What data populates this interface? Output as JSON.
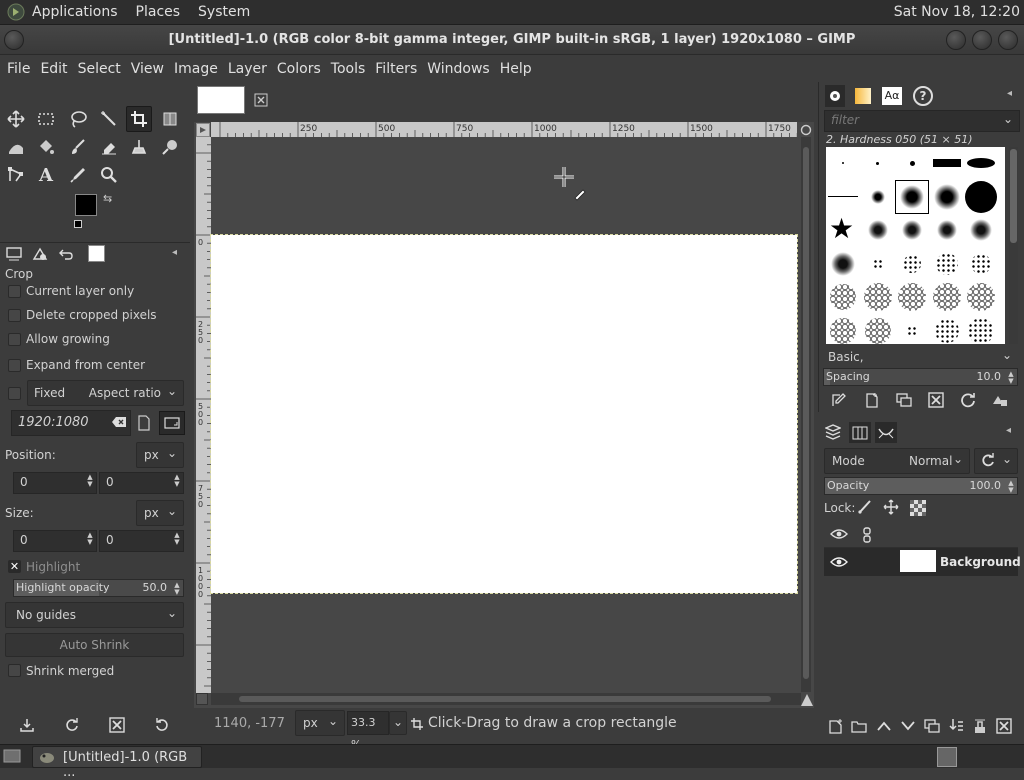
{
  "top_panel": {
    "menus": [
      "Applications",
      "Places",
      "System"
    ],
    "clock": "Sat Nov 18, 12:20"
  },
  "window": {
    "title": "[Untitled]-1.0 (RGB color 8-bit gamma integer, GIMP built-in sRGB, 1 layer) 1920x1080 – GIMP"
  },
  "menubar": {
    "items": [
      "File",
      "Edit",
      "Select",
      "View",
      "Image",
      "Layer",
      "Colors",
      "Tools",
      "Filters",
      "Windows",
      "Help"
    ]
  },
  "toolbox": {
    "tools": [
      "move-icon",
      "rect-select-icon",
      "lasso-icon",
      "fuzzy-select-icon",
      "crop-icon",
      "unified-transform-icon",
      "warp-icon",
      "bucket-fill-icon",
      "paintbrush-icon",
      "eraser-icon",
      "clone-icon",
      "smudge-icon",
      "paths-icon",
      "text-icon",
      "color-picker-icon",
      "zoom-icon"
    ],
    "active_tool": "crop-icon"
  },
  "tool_options": {
    "title": "Crop",
    "current_layer_only": "Current layer only",
    "delete_cropped_pixels": "Delete cropped pixels",
    "allow_growing": "Allow growing",
    "expand_from_center": "Expand from center",
    "fixed_label": "Fixed",
    "fixed_mode": "Aspect ratio",
    "ratio_value": "1920:1080",
    "position_label": "Position:",
    "position_unit": "px",
    "position_x": "0",
    "position_y": "0",
    "size_label": "Size:",
    "size_unit": "px",
    "size_w": "0",
    "size_h": "0",
    "highlight_label": "Highlight",
    "highlight_opacity_label": "Highlight opacity",
    "highlight_opacity_value": "50.0",
    "highlight_opacity_fraction": 0.5,
    "guides": "No guides",
    "auto_shrink": "Auto Shrink",
    "shrink_merged": "Shrink merged"
  },
  "canvas": {
    "ruler_h_labels": [
      "250",
      "500",
      "750",
      "1000",
      "1250",
      "1500",
      "1750"
    ],
    "ruler_v_labels": [
      "0",
      "250",
      "500",
      "750",
      "1000"
    ],
    "pointer_coords": "1140, -177",
    "unit": "px",
    "zoom": "33.3 %",
    "status_message": "Click-Drag to draw a crop rectangle"
  },
  "brushes": {
    "filter_placeholder": "filter",
    "selected_brush": "2. Hardness 050 (51 × 51)",
    "tag": "Basic,",
    "spacing_label": "Spacing",
    "spacing_value": "10.0"
  },
  "layers": {
    "mode_label": "Mode",
    "mode_value": "Normal",
    "opacity_label": "Opacity",
    "opacity_value": "100.0",
    "lock_label": "Lock:",
    "layer_name": "Background"
  },
  "taskbar": {
    "window_button": "[Untitled]-1.0 (RGB ..."
  },
  "colors": {
    "foreground": "#000000",
    "background": "#ffffff",
    "panel_bg": "#3c3c3c",
    "canvas_bg": "#474747"
  }
}
